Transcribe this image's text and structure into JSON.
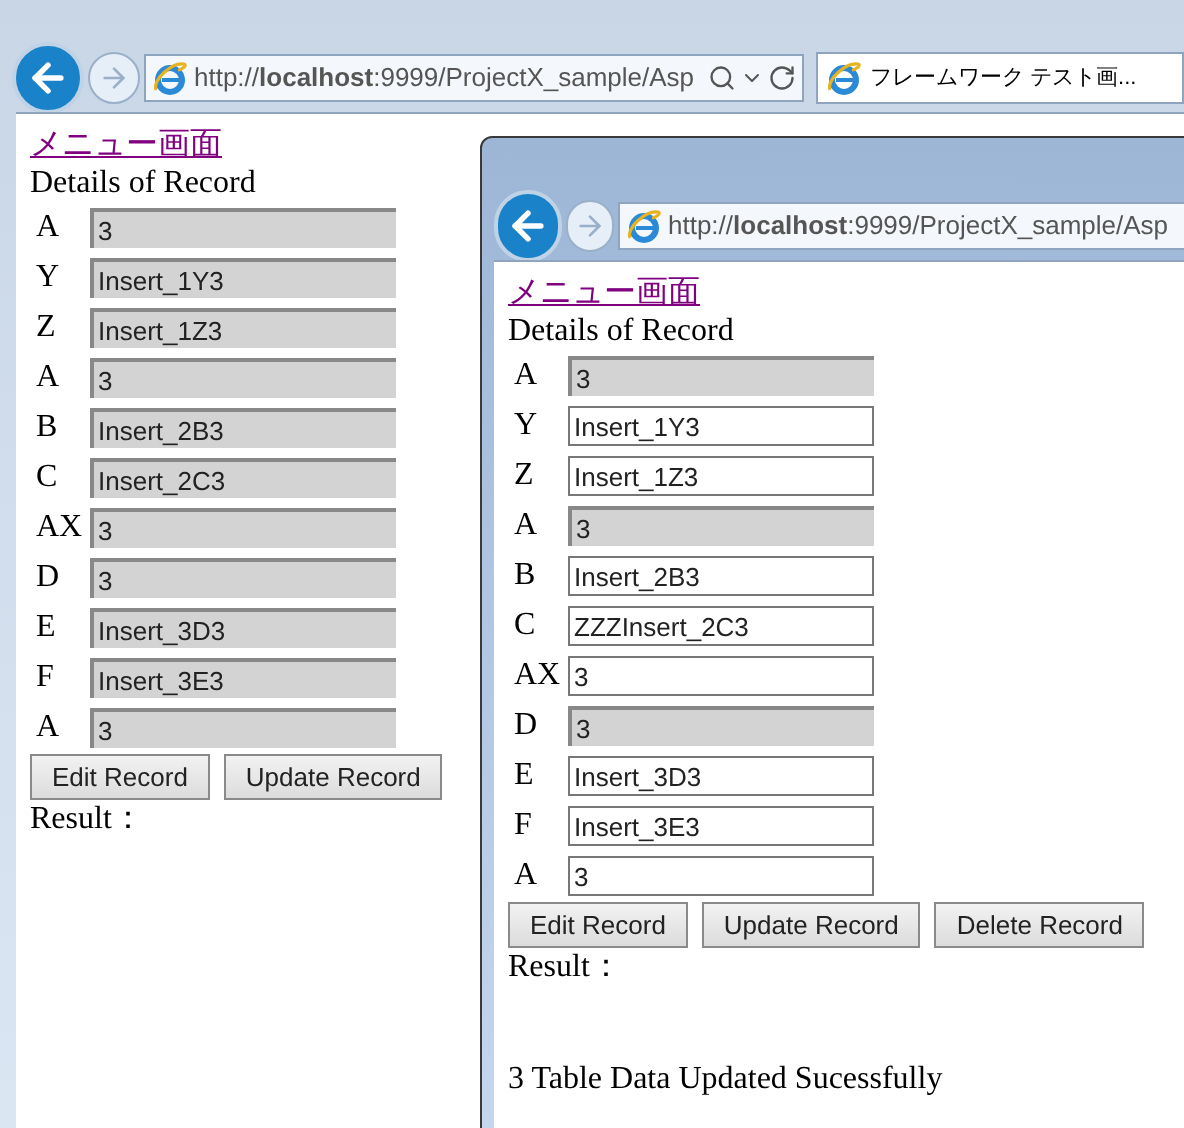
{
  "windows": [
    {
      "address": "http://**localhost**:9999/ProjectX_sample/Asp",
      "tab": "フレームワーク テスト画...",
      "menu_link": "メニュー画面",
      "heading": "Details of Record",
      "fields": [
        {
          "label": "A",
          "value": "3",
          "disabled": true
        },
        {
          "label": "Y",
          "value": "Insert_1Y3",
          "disabled": true
        },
        {
          "label": "Z",
          "value": "Insert_1Z3",
          "disabled": true
        },
        {
          "label": "A",
          "value": "3",
          "disabled": true
        },
        {
          "label": "B",
          "value": "Insert_2B3",
          "disabled": true
        },
        {
          "label": "C",
          "value": "Insert_2C3",
          "disabled": true
        },
        {
          "label": "AX",
          "value": "3",
          "disabled": true
        },
        {
          "label": "D",
          "value": "3",
          "disabled": true
        },
        {
          "label": "E",
          "value": "Insert_3D3",
          "disabled": true
        },
        {
          "label": "F",
          "value": "Insert_3E3",
          "disabled": true
        },
        {
          "label": "A",
          "value": "3",
          "disabled": true
        }
      ],
      "buttons": [
        "Edit Record",
        "Update Record"
      ],
      "result_label": "Result："
    },
    {
      "address": "http://**localhost**:9999/ProjectX_sample/Asp",
      "menu_link": "メニュー画面",
      "heading": "Details of Record",
      "fields": [
        {
          "label": "A",
          "value": "3",
          "disabled": true
        },
        {
          "label": "Y",
          "value": "Insert_1Y3",
          "disabled": false
        },
        {
          "label": "Z",
          "value": "Insert_1Z3",
          "disabled": false
        },
        {
          "label": "A",
          "value": "3",
          "disabled": true
        },
        {
          "label": "B",
          "value": "Insert_2B3",
          "disabled": false
        },
        {
          "label": "C",
          "value": "ZZZInsert_2C3",
          "disabled": false
        },
        {
          "label": "AX",
          "value": "3",
          "disabled": false
        },
        {
          "label": "D",
          "value": "3",
          "disabled": true
        },
        {
          "label": "E",
          "value": "Insert_3D3",
          "disabled": false
        },
        {
          "label": "F",
          "value": "Insert_3E3",
          "disabled": false
        },
        {
          "label": "A",
          "value": "3",
          "disabled": false
        }
      ],
      "buttons": [
        "Edit Record",
        "Update Record",
        "Delete Record"
      ],
      "result_label": "Result：",
      "message": "3 Table Data Updated Sucessfully"
    }
  ]
}
